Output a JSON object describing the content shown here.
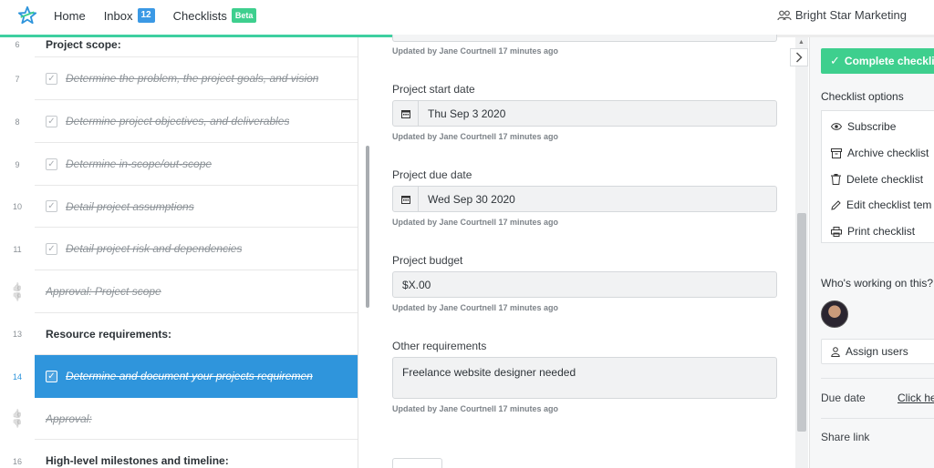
{
  "nav": {
    "home": "Home",
    "inbox": "Inbox",
    "inbox_count": "12",
    "checklists": "Checklists",
    "beta": "Beta",
    "org": "Bright Star Marketing"
  },
  "progress_fraction": 0.67,
  "tasks": [
    {
      "num": "6",
      "text": "Project scope:",
      "kind": "heading"
    },
    {
      "num": "7",
      "text": "Determine the problem, the project goals, and vision",
      "kind": "task"
    },
    {
      "num": "8",
      "text": "Determine project objectives, and deliverables",
      "kind": "task"
    },
    {
      "num": "9",
      "text": "Determine in-scope/out-scope",
      "kind": "task"
    },
    {
      "num": "10",
      "text": "Detail project assumptions",
      "kind": "task"
    },
    {
      "num": "11",
      "text": "Detail project risk and dependencies",
      "kind": "task"
    },
    {
      "num": "",
      "text": "Approval: Project scope",
      "kind": "approval"
    },
    {
      "num": "13",
      "text": "Resource requirements:",
      "kind": "heading"
    },
    {
      "num": "14",
      "text": "Determine and document your projects requiremen",
      "kind": "active"
    },
    {
      "num": "",
      "text": "Approval:",
      "kind": "approval"
    },
    {
      "num": "16",
      "text": "High-level milestones and timeline:",
      "kind": "heading"
    }
  ],
  "form": {
    "updated_text": "Updated by Jane Courtnell 17 minutes ago",
    "start_label": "Project start date",
    "start_value": "Thu Sep 3 2020",
    "due_label": "Project due date",
    "due_value": "Wed Sep 30 2020",
    "budget_label": "Project budget",
    "budget_value": "$X.00",
    "other_label": "Other requirements",
    "other_value": "Freelance website designer needed"
  },
  "sidebar": {
    "complete": "Complete checkli",
    "options_title": "Checklist options",
    "subscribe": "Subscribe",
    "archive": "Archive checklist",
    "delete": "Delete checklist",
    "edit": "Edit checklist tem",
    "print": "Print checklist",
    "working_title": "Who's working on this?",
    "assign": "Assign users",
    "due_label": "Due date",
    "due_link": "Click he",
    "share": "Share link"
  },
  "colors": {
    "accent_green": "#3ecf8e",
    "active_blue": "#2f95dc",
    "badge_blue": "#3b99e5"
  }
}
